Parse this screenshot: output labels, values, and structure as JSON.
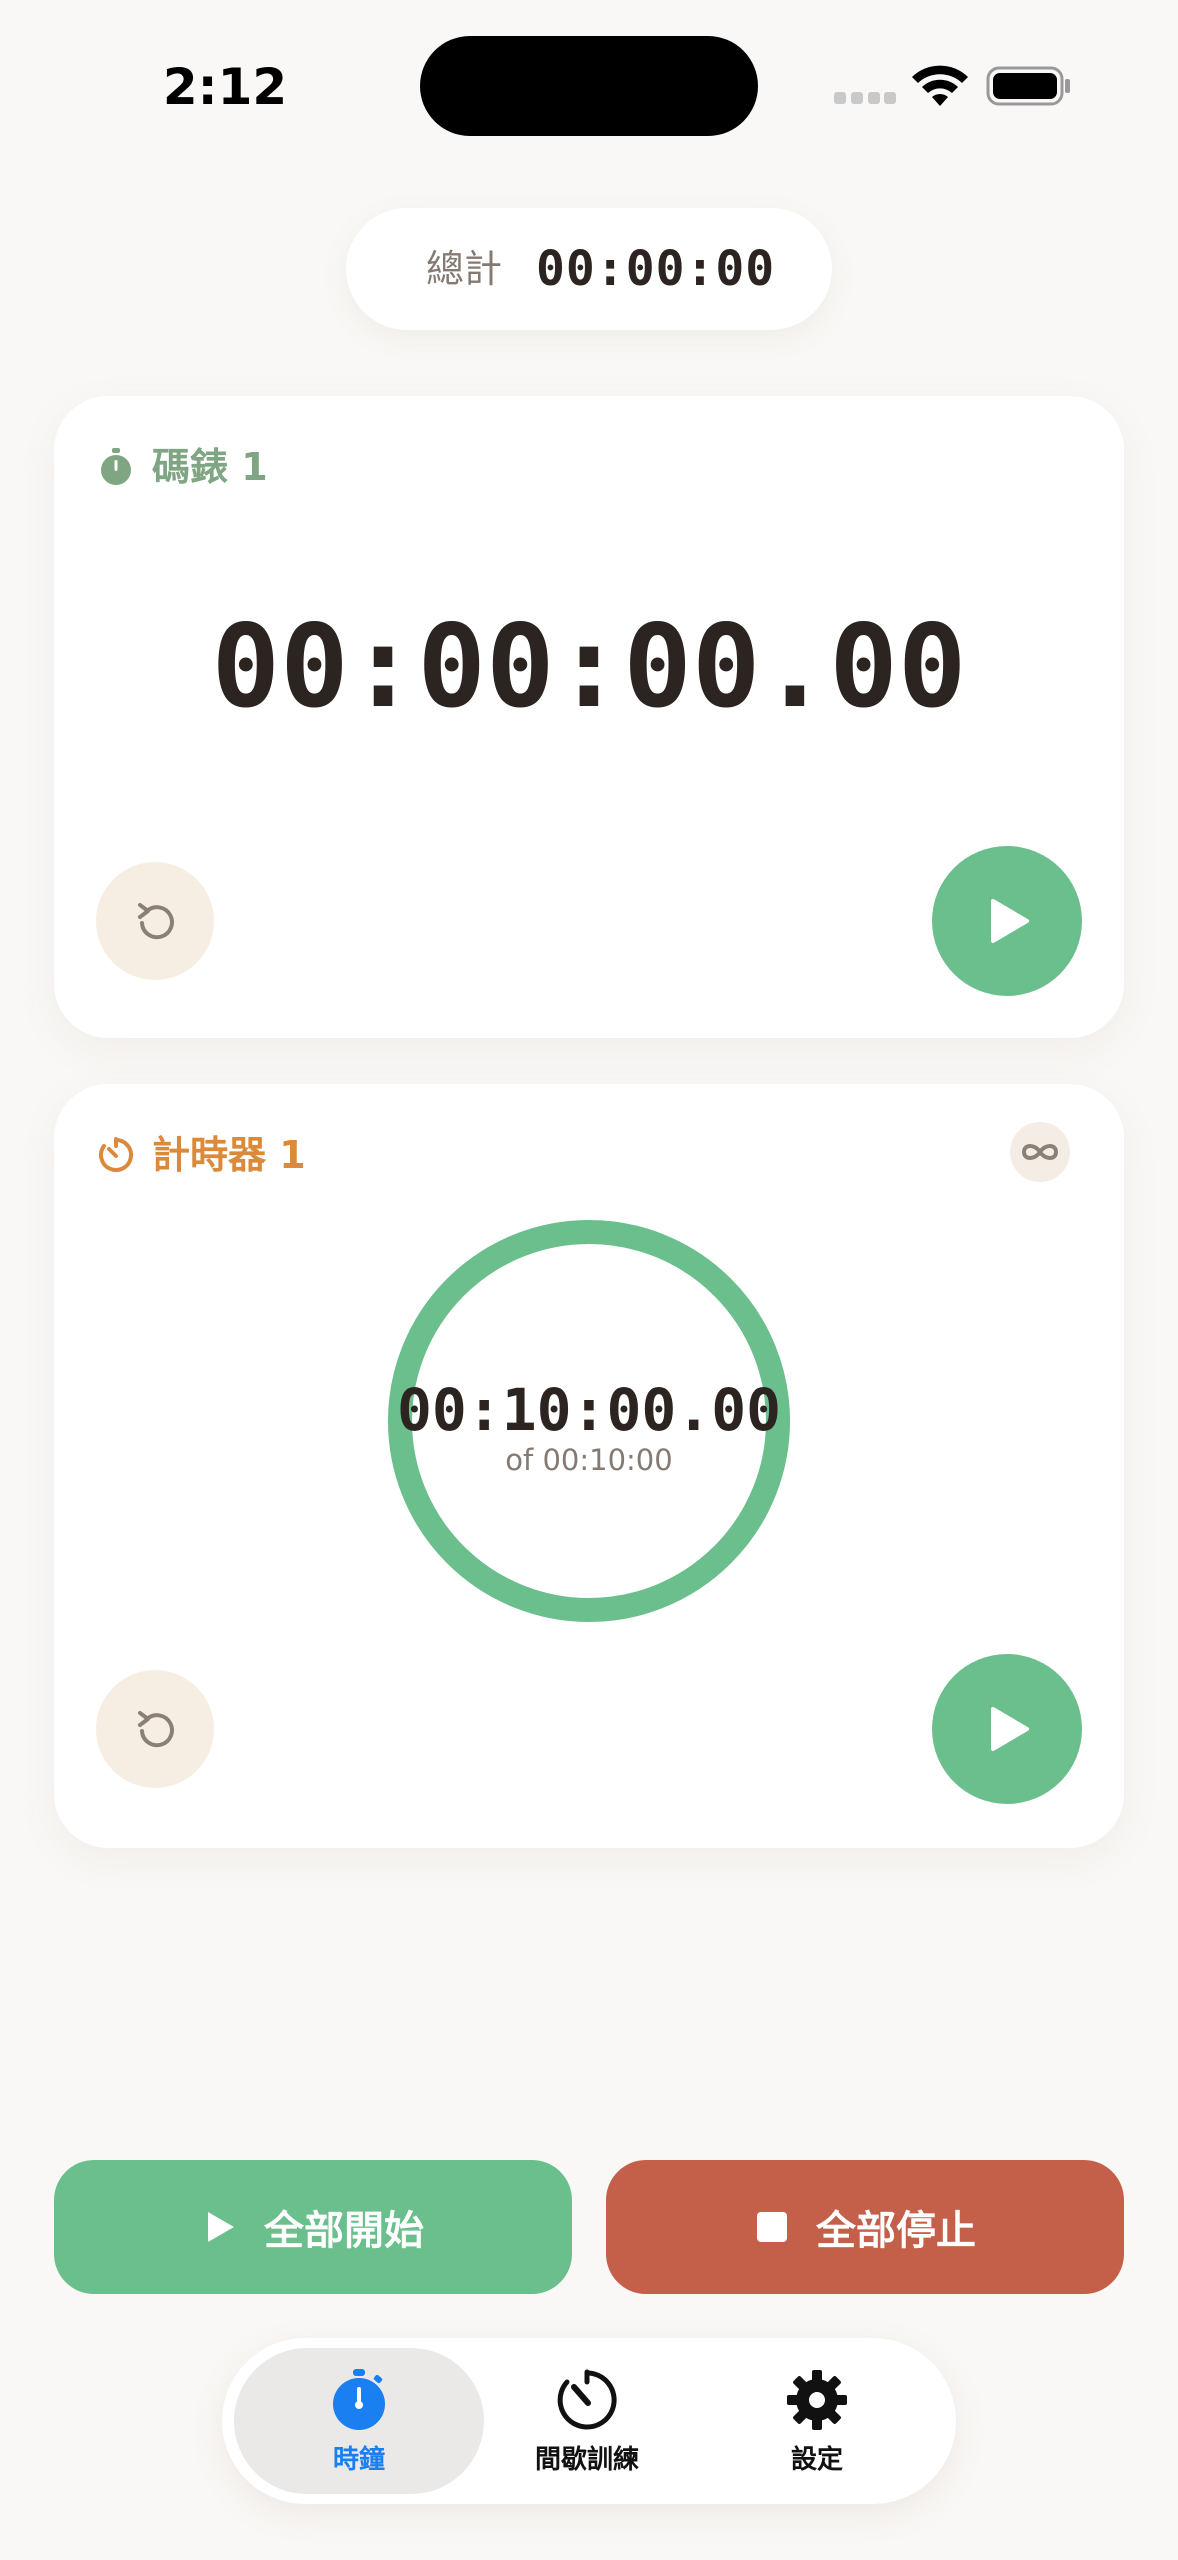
{
  "status_bar": {
    "time": "2:12",
    "icons": [
      "cellular-dots-icon",
      "wifi-icon",
      "battery-icon"
    ]
  },
  "total": {
    "label": "總計",
    "value": "00:00:00"
  },
  "stopwatch": {
    "title": "碼錶 1",
    "time": "00:00:00.00",
    "icon": "stopwatch-icon",
    "accent": "#7fa583"
  },
  "timer": {
    "title": "計時器 1",
    "time": "00:10:00.00",
    "subtitle": "of 00:10:00",
    "icon": "timer-icon",
    "progress": 1.0,
    "ring_color": "#6abf8c",
    "accent": "#db8a3c"
  },
  "actions": {
    "start_all": "全部開始",
    "stop_all": "全部停止",
    "start_color": "#6abf8c",
    "stop_color": "#c4604a"
  },
  "tabs": [
    {
      "label": "時鐘",
      "icon": "stopwatch-icon",
      "active": true
    },
    {
      "label": "間歇訓練",
      "icon": "interval-timer-icon",
      "active": false
    },
    {
      "label": "設定",
      "icon": "gear-icon",
      "active": false
    }
  ]
}
